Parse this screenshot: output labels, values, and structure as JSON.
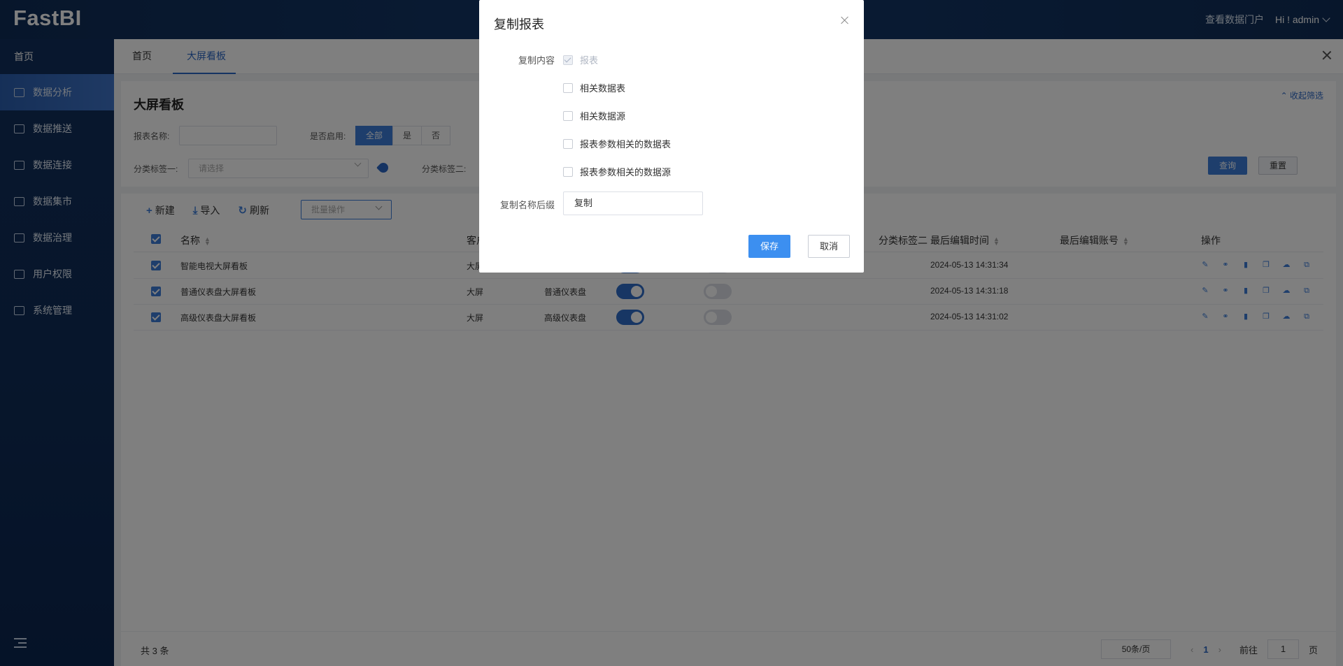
{
  "app": {
    "logo": "FastBI",
    "portal_link": "查看数据门户",
    "user_greeting": "Hi ! admin"
  },
  "sidebar": {
    "home": "首页",
    "items": [
      {
        "label": "数据分析",
        "icon": "chart-analysis-icon",
        "active": true
      },
      {
        "label": "数据推送",
        "icon": "push-icon",
        "active": false
      },
      {
        "label": "数据连接",
        "icon": "connection-icon",
        "active": false
      },
      {
        "label": "数据集市",
        "icon": "dataset-icon",
        "active": false
      },
      {
        "label": "数据治理",
        "icon": "governance-icon",
        "active": false
      },
      {
        "label": "用户权限",
        "icon": "user-permission-icon",
        "active": false
      },
      {
        "label": "系统管理",
        "icon": "system-icon",
        "active": false
      }
    ]
  },
  "tabs": [
    {
      "label": "首页",
      "active": false
    },
    {
      "label": "大屏看板",
      "active": true
    }
  ],
  "filter": {
    "title": "大屏看板",
    "collapse_label": "收起筛选",
    "name_label": "报表名称:",
    "name_value": "",
    "enabled_label": "是否启用:",
    "enabled_options": [
      "全部",
      "是",
      "否"
    ],
    "enabled_selected": "全部",
    "tag1_label": "分类标签一:",
    "tag1_placeholder": "请选择",
    "tag2_label": "分类标签二:",
    "query_button": "查询",
    "reset_button": "重置"
  },
  "toolbar": {
    "new_label": "新建",
    "import_label": "导入",
    "refresh_label": "刷新",
    "batch_placeholder": "批量操作"
  },
  "table": {
    "columns": {
      "name": "名称",
      "client": "客户",
      "tag2": "分类标签二",
      "edit_time": "最后编辑时间",
      "edit_account": "最后编辑账号",
      "ops": "操作"
    },
    "rows": [
      {
        "name": "智能电视大屏看板",
        "client": "大屏",
        "tag": "",
        "enabled": true,
        "switch2": false,
        "edit_time": "2024-05-13 14:31:34",
        "edit_account": ""
      },
      {
        "name": "普通仪表盘大屏看板",
        "client": "大屏",
        "tag": "普通仪表盘",
        "enabled": true,
        "switch2": false,
        "edit_time": "2024-05-13 14:31:18",
        "edit_account": ""
      },
      {
        "name": "高级仪表盘大屏看板",
        "client": "大屏",
        "tag": "高级仪表盘",
        "enabled": true,
        "switch2": false,
        "edit_time": "2024-05-13 14:31:02",
        "edit_account": ""
      }
    ]
  },
  "pagination": {
    "total_label": "共 3 条",
    "page_size": "50条/页",
    "current_page": "1",
    "goto_prefix": "前往",
    "goto_value": "1",
    "goto_suffix": "页"
  },
  "modal": {
    "title": "复制报表",
    "content_label": "复制内容",
    "options": [
      {
        "label": "报表",
        "checked": true,
        "disabled": true
      },
      {
        "label": "相关数据表",
        "checked": false,
        "disabled": false
      },
      {
        "label": "相关数据源",
        "checked": false,
        "disabled": false
      },
      {
        "label": "报表参数相关的数据表",
        "checked": false,
        "disabled": false
      },
      {
        "label": "报表参数相关的数据源",
        "checked": false,
        "disabled": false
      }
    ],
    "suffix_label": "复制名称后缀",
    "suffix_value": "复制",
    "save_button": "保存",
    "cancel_button": "取消"
  },
  "colors": {
    "primary": "#3c7dd9",
    "sidebar_bg": "#102f5c",
    "header_bg": "#0f2d57"
  }
}
